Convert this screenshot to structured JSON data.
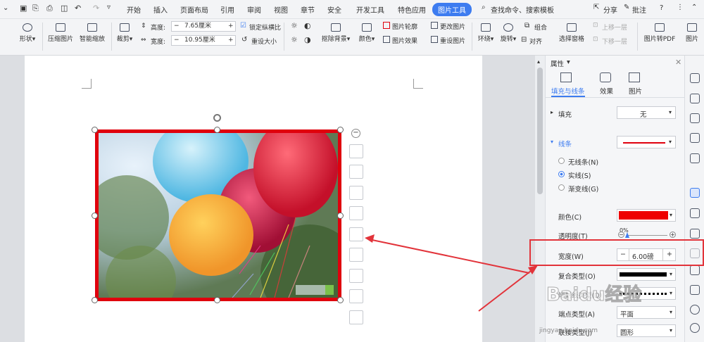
{
  "menu": {
    "tabs": [
      "开始",
      "插入",
      "页面布局",
      "引用",
      "审阅",
      "视图",
      "章节",
      "安全",
      "开发工具",
      "特色应用",
      "图片工具"
    ],
    "active_tab": "图片工具",
    "search": "查找命令、搜索模板",
    "share": "分享",
    "annotate": "批注",
    "help": "?"
  },
  "ribbon": {
    "shape": "形状",
    "compress": "压缩图片",
    "smart_zoom": "智能缩放",
    "crop": "裁剪",
    "height_label": "高度:",
    "height_value": "7.65厘米",
    "width_label": "宽度:",
    "width_value": "10.95厘米",
    "lock_ratio": "锁定纵横比",
    "reset_size": "重设大小",
    "remove_bg": "抠除背景",
    "color": "颜色",
    "outline": "图片轮廓",
    "effect": "图片效果",
    "change_pic": "更改图片",
    "reset_pic": "重设图片",
    "wrap": "环绕",
    "rotate": "旋转",
    "align": "对齐",
    "group": "组合",
    "selection_pane": "选择窗格",
    "bring_forward": "上移一层",
    "send_backward": "下移一层",
    "to_pdf": "图片转PDF",
    "to_text": "图片"
  },
  "panel": {
    "title": "属性",
    "tabs": [
      "填充与线条",
      "效果",
      "图片"
    ],
    "fill_label": "填充",
    "fill_value": "无",
    "line_label": "线条",
    "radio_none": "无线条(N)",
    "radio_solid": "实线(S)",
    "radio_gradient": "渐变线(G)",
    "color_label": "颜色(C)",
    "color_value": "#ee0000",
    "transparency_label": "透明度(T)",
    "transparency_value": "0%",
    "width_label": "宽度(W)",
    "width_value": "6.00磅",
    "compound_label": "复合类型(O)",
    "dash_label": "短划线类型(D)",
    "endpoint_label": "端点类型(A)",
    "endpoint_value": "平面",
    "join_label": "联接类型(J)",
    "join_value": "圆形"
  },
  "watermark": "Baidu经验",
  "watermark_url": "jingyan.baidu.com",
  "colors": {
    "accent": "#3d7cf0",
    "highlight": "#e2333a"
  }
}
